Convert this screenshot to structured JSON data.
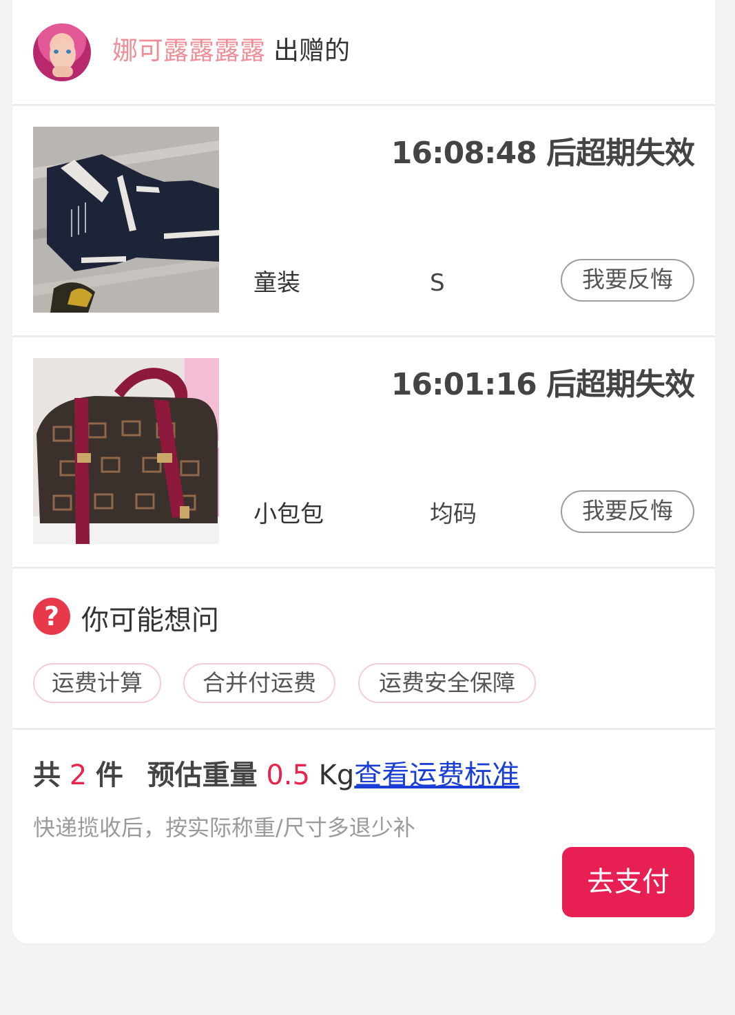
{
  "header": {
    "donor_name": "娜可露露露露",
    "verb": "出赠的"
  },
  "items": [
    {
      "timer": "16:08:48 后超期失效",
      "category": "童装",
      "size": "S",
      "regret_label": "我要反悔"
    },
    {
      "timer": "16:01:16 后超期失效",
      "category": "小包包",
      "size": "均码",
      "regret_label": "我要反悔"
    }
  ],
  "faq": {
    "title": "你可能想问",
    "icon": "question-icon",
    "chips": [
      "运费计算",
      "合并付运费",
      "运费安全保障"
    ]
  },
  "summary": {
    "total_prefix": "共",
    "count": "2",
    "count_unit": "件",
    "weight_label": "预估重量",
    "weight_value": "0.5",
    "weight_unit": "Kg",
    "link_text": "查看运费标准",
    "note": "快递揽收后，按实际称重/尺寸多退少补",
    "pay_label": "去支付"
  },
  "colors": {
    "accent": "#e81f53",
    "donor_name": "#ef8e96",
    "link": "#1a3fd6"
  }
}
